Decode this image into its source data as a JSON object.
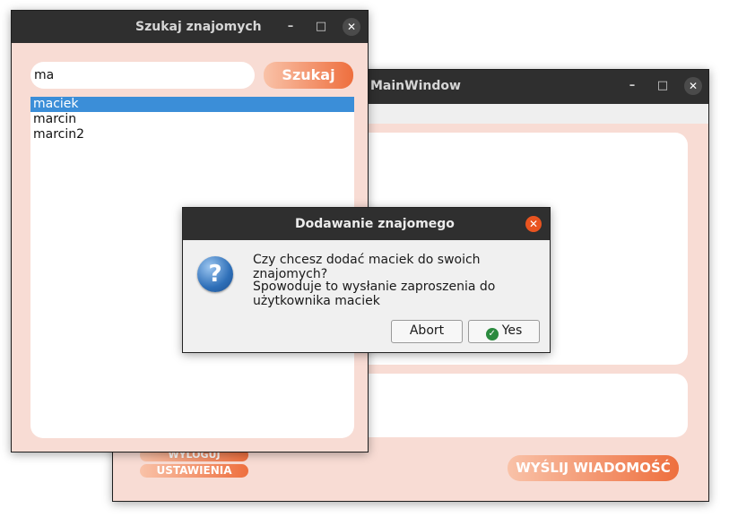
{
  "main_window": {
    "title": "MainWindow",
    "controls": {
      "minimize": "–",
      "maximize": "□",
      "close": "✕"
    },
    "buttons": {
      "logout_label": "WYLOGUJ",
      "settings_label": "USTAWIENIA",
      "send_label": "WYŚLIJ WIADOMOŚĆ"
    }
  },
  "search_window": {
    "title": "Szukaj znajomych",
    "controls": {
      "minimize": "–",
      "maximize": "□",
      "close": "✕"
    },
    "search_value": "ma",
    "search_button_label": "Szukaj",
    "results": [
      "maciek",
      "marcin",
      "marcin2"
    ],
    "selected_index": 0
  },
  "dialog": {
    "title": "Dodawanie znajomego",
    "question_icon": "?",
    "message_line1": "Czy chcesz dodać maciek do swoich znajomych?",
    "message_line2": "Spowoduje to wysłanie zaproszenia do",
    "message_line3": "użytkownika maciek",
    "abort_label": "Abort",
    "yes_label": "Yes",
    "close": "✕"
  },
  "colors": {
    "window_bg": "#f8dcd4",
    "accent_gradient_start": "#f9c2a8",
    "accent_gradient_end": "#ee6f3e",
    "selection": "#3b8ed8",
    "titlebar": "#2f2f2f",
    "dialog_close": "#e95420"
  }
}
